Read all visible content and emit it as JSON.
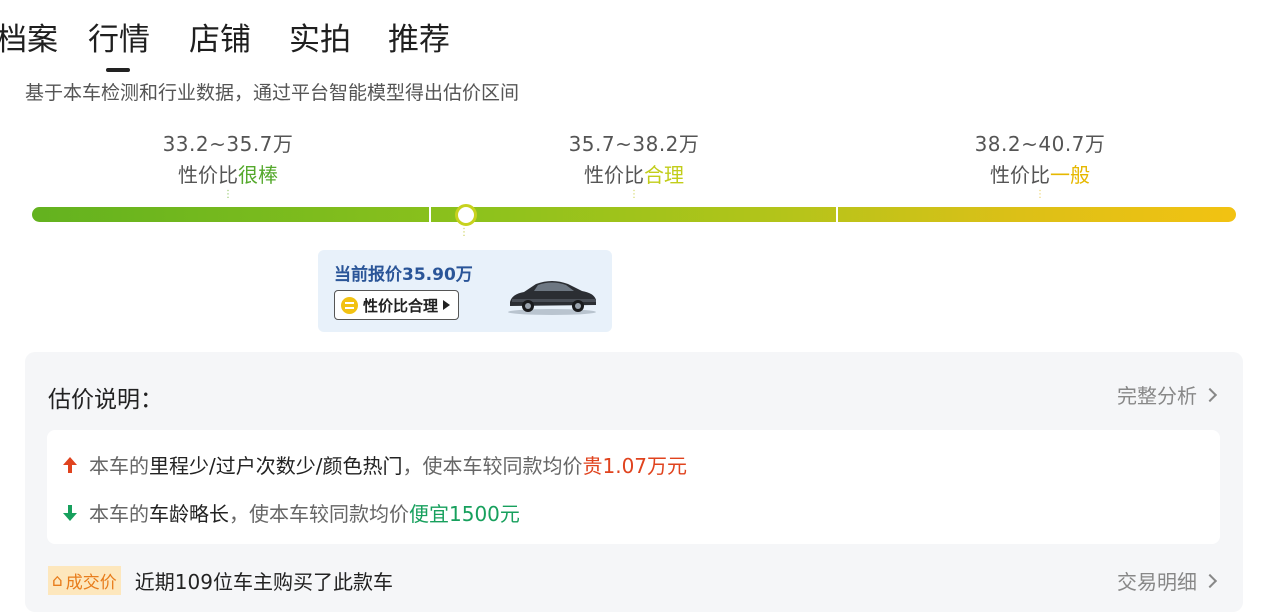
{
  "tabs": [
    "档案",
    "行情",
    "店铺",
    "实拍",
    "推荐"
  ],
  "active_tab": "行情",
  "subtitle": "基于本车检测和行业数据，通过平台智能模型得出估价区间",
  "ranges": [
    {
      "price": "33.2~35.7万",
      "label_prefix": "性价比",
      "label_level": "很棒",
      "color": "#55a92c"
    },
    {
      "price": "35.7~38.2万",
      "label_prefix": "性价比",
      "label_level": "合理",
      "color": "#c2cd1a"
    },
    {
      "price": "38.2~40.7万",
      "label_prefix": "性价比",
      "label_level": "一般",
      "color": "#e6b800"
    }
  ],
  "price_bar": {
    "colors": [
      "#63b21f",
      "#b3c41a",
      "#f2c212"
    ]
  },
  "current_price": {
    "text": "当前报价35.90万",
    "badge": "性价比合理",
    "car_icon": "car-image"
  },
  "estimate": {
    "title": "估价说明：",
    "full_analysis": "完整分析",
    "reasons": [
      {
        "direction": "up",
        "icon": "arrow-up-icon",
        "prefix": "本车的",
        "factors": "里程少/过户次数少/颜色热门",
        "mid": "，使本车较同款均价",
        "result": "贵1.07万元",
        "color": "#e0431e"
      },
      {
        "direction": "down",
        "icon": "arrow-down-icon",
        "prefix": "本车的",
        "factors": "车龄略长",
        "mid": "，使本车较同款均价",
        "result": "便宜1500元",
        "color": "#17a05d"
      }
    ]
  },
  "deal": {
    "tag": "成交价",
    "text": "近期109位车主购买了此款车",
    "link": "交易明细"
  }
}
